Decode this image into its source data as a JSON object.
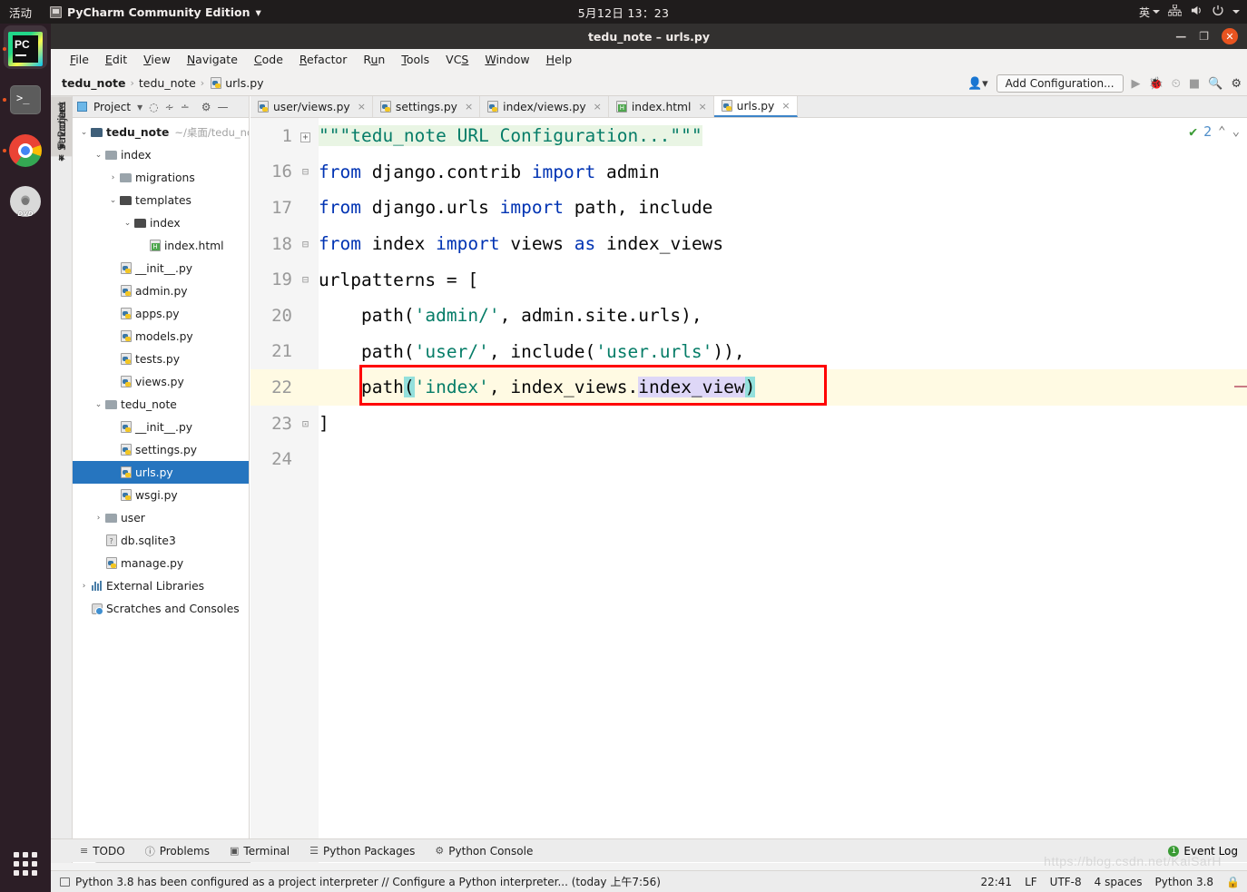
{
  "gnome": {
    "activities": "活动",
    "app_name": "PyCharm Community Edition",
    "app_caret": "▾",
    "clock": "5月12日  13：23",
    "input_method": "英",
    "caret": "▾",
    "icons": {
      "network": "network-icon",
      "volume": "volume-icon",
      "power": "power-icon"
    }
  },
  "dock": {
    "items": [
      {
        "name": "pycharm",
        "label": "PC",
        "running": true,
        "active": true
      },
      {
        "name": "terminal",
        "label": ">_",
        "running": true,
        "active": false
      },
      {
        "name": "chrome",
        "label": "",
        "running": true,
        "active": false
      },
      {
        "name": "dvd",
        "label": "DVD",
        "running": false,
        "active": false
      }
    ],
    "show_apps": "show-applications"
  },
  "window": {
    "title": "tedu_note – urls.py",
    "minimize": "—",
    "maximize": "❐",
    "close": "✕"
  },
  "menubar": [
    {
      "label": "File",
      "mnemonic": "F"
    },
    {
      "label": "Edit",
      "mnemonic": "E"
    },
    {
      "label": "View",
      "mnemonic": "V"
    },
    {
      "label": "Navigate",
      "mnemonic": "N"
    },
    {
      "label": "Code",
      "mnemonic": "C"
    },
    {
      "label": "Refactor",
      "mnemonic": "R"
    },
    {
      "label": "Run",
      "mnemonic": "u"
    },
    {
      "label": "Tools",
      "mnemonic": "T"
    },
    {
      "label": "VCS",
      "mnemonic": "S"
    },
    {
      "label": "Window",
      "mnemonic": "W"
    },
    {
      "label": "Help",
      "mnemonic": "H"
    }
  ],
  "navbar": {
    "breadcrumbs": [
      "tedu_note",
      "tedu_note",
      "urls.py"
    ],
    "separator": "›",
    "add_configuration": "Add Configuration...",
    "icons": [
      "user-avatar-icon",
      "run-icon",
      "debug-icon",
      "run-coverage-icon",
      "stop-icon",
      "search-icon",
      "settings-gear-icon"
    ]
  },
  "toolstrip": {
    "project_tab": "Project",
    "structure_tab": "Structure",
    "favorites_tab": "Favorites"
  },
  "project_panel": {
    "title": "Project",
    "caret": "▾",
    "icons": [
      "locate-icon",
      "expand-all-icon",
      "collapse-all-icon",
      "settings-gear-icon",
      "hide-icon"
    ],
    "tree": [
      {
        "label": "tedu_note",
        "suffix": "~/桌面/tedu_not",
        "depth": 0,
        "arrow": "v",
        "icon": "folder-src",
        "bold": true,
        "selected": false
      },
      {
        "label": "index",
        "depth": 1,
        "arrow": "v",
        "icon": "folder-light",
        "selected": false
      },
      {
        "label": "migrations",
        "depth": 2,
        "arrow": ">",
        "icon": "folder-light",
        "selected": false
      },
      {
        "label": "templates",
        "depth": 2,
        "arrow": "v",
        "icon": "folder",
        "selected": false
      },
      {
        "label": "index",
        "depth": 3,
        "arrow": "v",
        "icon": "folder",
        "selected": false
      },
      {
        "label": "index.html",
        "depth": 4,
        "arrow": "",
        "icon": "html-file",
        "selected": false
      },
      {
        "label": "__init__.py",
        "depth": 2,
        "arrow": "",
        "icon": "py-file",
        "selected": false
      },
      {
        "label": "admin.py",
        "depth": 2,
        "arrow": "",
        "icon": "py-file",
        "selected": false
      },
      {
        "label": "apps.py",
        "depth": 2,
        "arrow": "",
        "icon": "py-file",
        "selected": false
      },
      {
        "label": "models.py",
        "depth": 2,
        "arrow": "",
        "icon": "py-file",
        "selected": false
      },
      {
        "label": "tests.py",
        "depth": 2,
        "arrow": "",
        "icon": "py-file",
        "selected": false
      },
      {
        "label": "views.py",
        "depth": 2,
        "arrow": "",
        "icon": "py-file",
        "selected": false
      },
      {
        "label": "tedu_note",
        "depth": 1,
        "arrow": "v",
        "icon": "folder-light",
        "selected": false
      },
      {
        "label": "__init__.py",
        "depth": 2,
        "arrow": "",
        "icon": "py-file",
        "selected": false
      },
      {
        "label": "settings.py",
        "depth": 2,
        "arrow": "",
        "icon": "py-file",
        "selected": false
      },
      {
        "label": "urls.py",
        "depth": 2,
        "arrow": "",
        "icon": "py-file",
        "selected": true
      },
      {
        "label": "wsgi.py",
        "depth": 2,
        "arrow": "",
        "icon": "py-file",
        "selected": false
      },
      {
        "label": "user",
        "depth": 1,
        "arrow": ">",
        "icon": "folder-light",
        "selected": false
      },
      {
        "label": "db.sqlite3",
        "depth": 1,
        "arrow": "",
        "icon": "db-file",
        "selected": false
      },
      {
        "label": "manage.py",
        "depth": 1,
        "arrow": "",
        "icon": "py-file",
        "selected": false
      },
      {
        "label": "External Libraries",
        "depth": 0,
        "arrow": ">",
        "icon": "lib-icon",
        "selected": false
      },
      {
        "label": "Scratches and Consoles",
        "depth": 0,
        "arrow": "",
        "icon": "scratch-icon",
        "selected": false
      }
    ]
  },
  "editor": {
    "tabs": [
      {
        "label": "user/views.py",
        "icon": "py-file",
        "active": false,
        "close": "×"
      },
      {
        "label": "settings.py",
        "icon": "py-file",
        "active": false,
        "close": "×"
      },
      {
        "label": "index/views.py",
        "icon": "py-file",
        "active": false,
        "close": "×"
      },
      {
        "label": "index.html",
        "icon": "html-file",
        "active": false,
        "close": "×"
      },
      {
        "label": "urls.py",
        "icon": "py-file",
        "active": true,
        "close": "×"
      }
    ],
    "inspection": {
      "check": "✔",
      "count": "2",
      "up": "⌃",
      "down": "⌄"
    },
    "lines": [
      {
        "num": "1",
        "fold": "+",
        "highlight": false
      },
      {
        "num": "16",
        "fold": "-",
        "highlight": false
      },
      {
        "num": "17",
        "fold": "",
        "highlight": false
      },
      {
        "num": "18",
        "fold": "-",
        "highlight": false
      },
      {
        "num": "19",
        "fold": "-",
        "highlight": false
      },
      {
        "num": "20",
        "fold": "",
        "highlight": false
      },
      {
        "num": "21",
        "fold": "",
        "highlight": false
      },
      {
        "num": "22",
        "fold": "",
        "highlight": true
      },
      {
        "num": "23",
        "fold": "-",
        "highlight": false
      },
      {
        "num": "24",
        "fold": "",
        "highlight": false
      }
    ],
    "code": {
      "l1": "\"\"\"tedu_note URL Configuration...\"\"\"",
      "l16_from": "from",
      "l16_mod": " django.contrib ",
      "l16_import": "import",
      "l16_tail": " admin",
      "l17_from": "from",
      "l17_mod": " django.urls ",
      "l17_import": "import",
      "l17_tail": " path, include",
      "l18_from": "from",
      "l18_mod": " index ",
      "l18_import": "import",
      "l18_mid": " views ",
      "l18_as": "as",
      "l18_tail": " index_views",
      "l19": "urlpatterns = [",
      "l20_a": "    path(",
      "l20_s": "'admin/'",
      "l20_b": ", admin.site.urls),",
      "l21_a": "    path(",
      "l21_s1": "'user/'",
      "l21_b": ", include(",
      "l21_s2": "'user.urls'",
      "l21_c": ")),",
      "l22_a": "    path",
      "l22_open": "(",
      "l22_s": "'index'",
      "l22_b": ", index_views.",
      "l22_ident": "index_view",
      "l22_close": ")",
      "l23": "]",
      "l24": ""
    }
  },
  "bottom_bar": {
    "items": [
      {
        "label": "TODO",
        "icon": "todo-icon"
      },
      {
        "label": "Problems",
        "icon": "problems-icon"
      },
      {
        "label": "Terminal",
        "icon": "terminal-icon"
      },
      {
        "label": "Python Packages",
        "icon": "packages-icon"
      },
      {
        "label": "Python Console",
        "icon": "python-console-icon"
      }
    ],
    "event_log": {
      "label": "Event Log",
      "badge": "1"
    }
  },
  "status_bar": {
    "message": "Python 3.8 has been configured as a project interpreter // Configure a Python interpreter... (today 上午7:56)",
    "caret_position": "22:41",
    "line_separator": "LF",
    "encoding": "UTF-8",
    "indent": "4 spaces",
    "interpreter": "Python 3.8",
    "lock": "lock-icon"
  },
  "watermark": "https://blog.csdn.net/KaiSarH",
  "colors": {
    "accent": "#2675bf",
    "keyword": "#0033b3",
    "string": "#067d68",
    "highlight_box": "#ff0000",
    "current_line": "#fffae3",
    "docstring_bg": "#e9f5e4"
  }
}
